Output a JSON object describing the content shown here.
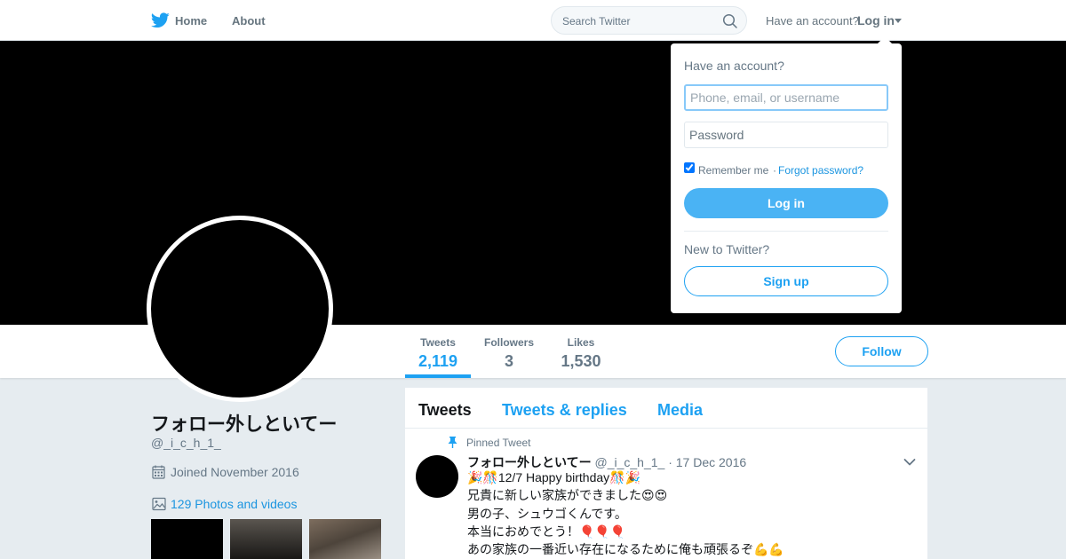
{
  "nav": {
    "home_label": "Home",
    "about_label": "About",
    "search_placeholder": "Search Twitter",
    "have_account": "Have an account?",
    "login_label": "Log in"
  },
  "profile": {
    "name": "フォロー外しといてー",
    "handle": "@_i_c_h_1_",
    "joined": "Joined November 2016",
    "photos": "129 Photos and videos",
    "follow_label": "Follow"
  },
  "stats": [
    {
      "label": "Tweets",
      "value": "2,119"
    },
    {
      "label": "Followers",
      "value": "3"
    },
    {
      "label": "Likes",
      "value": "1,530"
    }
  ],
  "timeline": {
    "tabs": [
      "Tweets",
      "Tweets & replies",
      "Media"
    ],
    "pinned_label": "Pinned Tweet",
    "tweet": {
      "name": "フォロー外しといてー",
      "handle": "@_i_c_h_1_",
      "separator": "·",
      "date": "17 Dec 2016",
      "lines": [
        "🎉🎊12/7 Happy birthday🎊🎉",
        "兄貴に新しい家族ができました😍😍",
        "男の子、シュウゴくんです。",
        "本当におめでとう！🎈🎈🎈",
        "あの家族の一番近い存在になるために俺も頑張るぞ💪💪"
      ]
    }
  },
  "login_dropdown": {
    "title": "Have an account?",
    "username_placeholder": "Phone, email, or username",
    "password_placeholder": "Password",
    "remember_me": "Remember me",
    "separator": "·",
    "forgot_password": "Forgot password?",
    "login_button": "Log in",
    "new_to_twitter": "New to Twitter?",
    "signup_button": "Sign up"
  },
  "colors": {
    "accent": "#1da1f2",
    "banner": "#000000",
    "page_background": "#e6ecf0"
  }
}
